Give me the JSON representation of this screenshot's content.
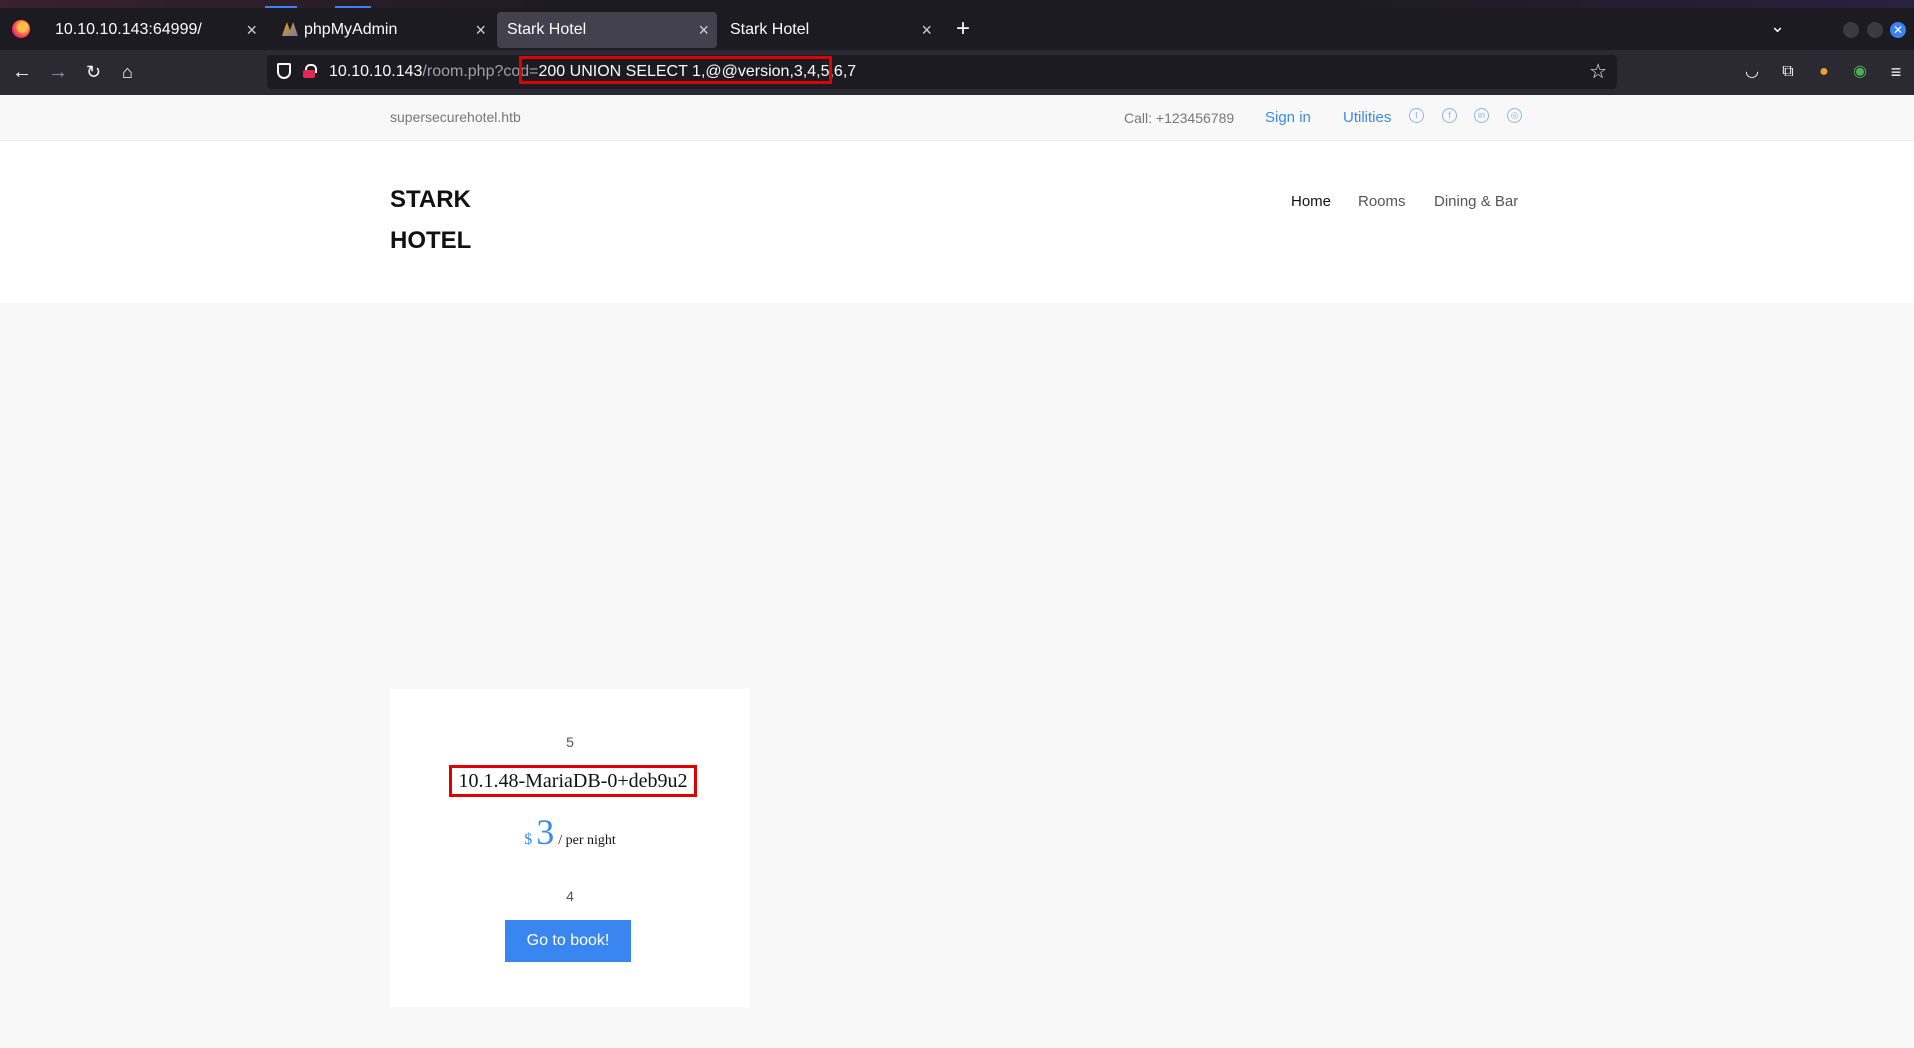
{
  "browser": {
    "tabs": [
      {
        "title": "10.10.10.143:64999/"
      },
      {
        "title": "phpMyAdmin"
      },
      {
        "title": "Stark Hotel"
      },
      {
        "title": "Stark Hotel"
      }
    ],
    "url": {
      "host": "10.10.10.143",
      "path": "/room.php?cod=",
      "query": "200 UNION SELECT 1,@@version,3,4,5,6,7"
    }
  },
  "site": {
    "domain": "supersecurehotel.htb",
    "call": "Call: +123456789",
    "sign_in": "Sign in",
    "utilities": "Utilities",
    "logo": "STARK HOTEL",
    "nav": [
      "Home",
      "Rooms",
      "Dining & Bar"
    ]
  },
  "room_card": {
    "top_value": "5",
    "name": "10.1.48-MariaDB-0+deb9u2",
    "currency": "$",
    "price": "3",
    "per_night": "/ per night",
    "bottom_value": "4",
    "button": "Go to book!"
  },
  "colors": {
    "accent": "#3a86f0",
    "highlight": "#e00000"
  }
}
